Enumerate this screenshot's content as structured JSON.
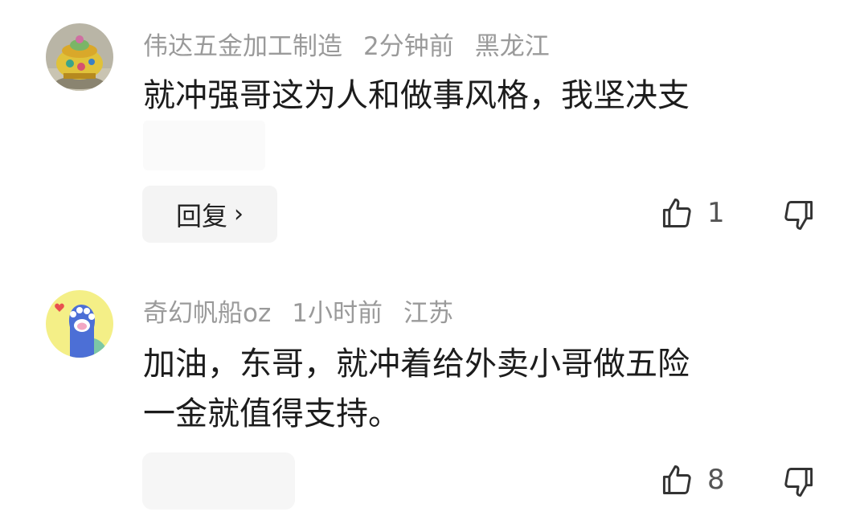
{
  "comments": [
    {
      "username": "伟达五金加工制造",
      "time": "2分钟前",
      "location": "黑龙江",
      "text": "就冲强哥这为人和做事风格，我坚决支",
      "reply_label": "回复",
      "reply_chevron": "›",
      "likes": "1",
      "avatar_icon": "teapot-avatar-icon"
    },
    {
      "username": "奇幻帆船oz",
      "time": "1小时前",
      "location": "江苏",
      "text_line1": "加油，东哥，就冲着给外卖小哥做五险",
      "text_line2": "一金就值得支持。",
      "likes": "8",
      "avatar_icon": "cat-paw-avatar-icon"
    }
  ],
  "colors": {
    "meta": "#9a9a9a",
    "text": "#1c1c1c",
    "button_bg": "#f4f4f4",
    "avatar2_bg": "#f4ef87",
    "paw": "#4c6fd6"
  }
}
